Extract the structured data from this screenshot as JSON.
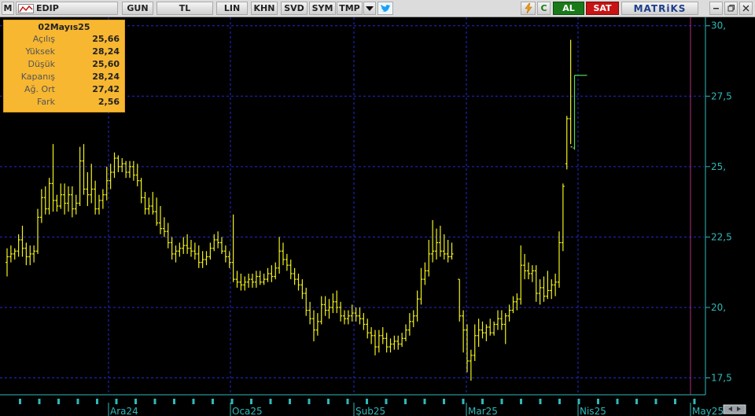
{
  "toolbar": {
    "logo_letter": "M",
    "symbol": "EDIP",
    "period": "GUN",
    "currency": "TL",
    "scale": "LIN",
    "buttons": [
      "KHN",
      "SVD",
      "SYM",
      "TMP"
    ],
    "c_label": "C",
    "buy_label": "AL",
    "sell_label": "SAT",
    "brand": "MATRiKS",
    "icons": [
      "chart-mode-icon",
      "dropdown-arrow-icon",
      "twitter-icon",
      "lightning-icon",
      "minimize-icon",
      "restore-icon",
      "close-icon"
    ]
  },
  "infobox": {
    "date": "02Mayıs25",
    "rows": [
      {
        "label": "Açılış",
        "value": "25,66"
      },
      {
        "label": "Yüksek",
        "value": "28,24"
      },
      {
        "label": "Düşük",
        "value": "25,60"
      },
      {
        "label": "Kapanış",
        "value": "28,24"
      },
      {
        "label": "Ağ. Ort",
        "value": "27,42"
      },
      {
        "label": "Fark",
        "value": "2,56"
      }
    ]
  },
  "colors": {
    "background": "#000000",
    "bars": "#f2f21a",
    "last_bar": "#5ad85a",
    "axis": "#2fb9b9",
    "grid": "#1f2bd0",
    "cursor_line": "#b0307a",
    "infobox_bg": "#f7b731"
  },
  "chart_data": {
    "type": "ohlc",
    "title": "EDIP",
    "y_ticks": [
      "30,",
      "27,5",
      "25,",
      "22,5",
      "20,",
      "17,5"
    ],
    "y_tick_values": [
      30,
      27.5,
      25,
      22.5,
      20,
      17.5
    ],
    "ylim": [
      16.9,
      30.3
    ],
    "x_labels": [
      "Ara24",
      "Oca25",
      "Şub25",
      "Mar25",
      "Nis25",
      "May25"
    ],
    "grid": true,
    "bars": [
      {
        "o": 21.6,
        "h": 22.1,
        "l": 21.1,
        "c": 21.8
      },
      {
        "o": 21.8,
        "h": 22.2,
        "l": 21.6,
        "c": 21.9
      },
      {
        "o": 21.9,
        "h": 22.1,
        "l": 21.7,
        "c": 22.0
      },
      {
        "o": 22.0,
        "h": 22.6,
        "l": 21.8,
        "c": 22.4
      },
      {
        "o": 22.4,
        "h": 22.9,
        "l": 21.8,
        "c": 22.1
      },
      {
        "o": 22.1,
        "h": 22.3,
        "l": 21.5,
        "c": 21.8
      },
      {
        "o": 21.8,
        "h": 22.2,
        "l": 21.5,
        "c": 21.9
      },
      {
        "o": 21.9,
        "h": 22.2,
        "l": 21.6,
        "c": 22.0
      },
      {
        "o": 22.0,
        "h": 23.5,
        "l": 21.9,
        "c": 23.2
      },
      {
        "o": 23.2,
        "h": 24.2,
        "l": 23.0,
        "c": 23.9
      },
      {
        "o": 23.9,
        "h": 24.3,
        "l": 23.3,
        "c": 23.5
      },
      {
        "o": 23.5,
        "h": 24.6,
        "l": 23.3,
        "c": 24.4
      },
      {
        "o": 24.4,
        "h": 25.8,
        "l": 23.4,
        "c": 23.8
      },
      {
        "o": 23.8,
        "h": 24.0,
        "l": 23.4,
        "c": 23.6
      },
      {
        "o": 23.6,
        "h": 24.4,
        "l": 23.5,
        "c": 24.0
      },
      {
        "o": 24.0,
        "h": 24.4,
        "l": 23.3,
        "c": 23.7
      },
      {
        "o": 23.7,
        "h": 24.3,
        "l": 23.4,
        "c": 24.0
      },
      {
        "o": 24.0,
        "h": 24.3,
        "l": 23.2,
        "c": 23.5
      },
      {
        "o": 23.5,
        "h": 24.0,
        "l": 23.3,
        "c": 23.7
      },
      {
        "o": 23.7,
        "h": 25.7,
        "l": 23.6,
        "c": 25.2
      },
      {
        "o": 25.2,
        "h": 25.8,
        "l": 24.0,
        "c": 24.2
      },
      {
        "o": 24.2,
        "h": 24.8,
        "l": 23.6,
        "c": 24.0
      },
      {
        "o": 24.0,
        "h": 25.1,
        "l": 23.7,
        "c": 24.2
      },
      {
        "o": 24.2,
        "h": 24.5,
        "l": 23.3,
        "c": 23.5
      },
      {
        "o": 23.5,
        "h": 24.0,
        "l": 23.3,
        "c": 23.8
      },
      {
        "o": 23.8,
        "h": 24.2,
        "l": 23.5,
        "c": 24.0
      },
      {
        "o": 24.0,
        "h": 25.0,
        "l": 23.8,
        "c": 24.5
      },
      {
        "o": 24.5,
        "h": 25.1,
        "l": 24.2,
        "c": 24.8
      },
      {
        "o": 24.8,
        "h": 25.5,
        "l": 24.6,
        "c": 25.3
      },
      {
        "o": 25.3,
        "h": 25.4,
        "l": 24.8,
        "c": 25.0
      },
      {
        "o": 25.0,
        "h": 25.3,
        "l": 24.8,
        "c": 25.1
      },
      {
        "o": 25.1,
        "h": 25.2,
        "l": 24.6,
        "c": 24.8
      },
      {
        "o": 24.8,
        "h": 25.2,
        "l": 24.6,
        "c": 25.0
      },
      {
        "o": 25.0,
        "h": 25.2,
        "l": 24.5,
        "c": 24.7
      },
      {
        "o": 24.7,
        "h": 25.1,
        "l": 24.3,
        "c": 24.5
      },
      {
        "o": 24.5,
        "h": 24.6,
        "l": 23.7,
        "c": 23.9
      },
      {
        "o": 23.9,
        "h": 24.1,
        "l": 23.3,
        "c": 23.5
      },
      {
        "o": 23.5,
        "h": 23.9,
        "l": 23.3,
        "c": 23.6
      },
      {
        "o": 23.6,
        "h": 24.1,
        "l": 23.3,
        "c": 23.4
      },
      {
        "o": 23.4,
        "h": 23.9,
        "l": 22.9,
        "c": 23.0
      },
      {
        "o": 23.0,
        "h": 23.6,
        "l": 22.6,
        "c": 22.8
      },
      {
        "o": 22.8,
        "h": 23.2,
        "l": 22.5,
        "c": 22.7
      },
      {
        "o": 22.7,
        "h": 23.0,
        "l": 22.1,
        "c": 22.3
      },
      {
        "o": 22.3,
        "h": 22.5,
        "l": 21.7,
        "c": 21.9
      },
      {
        "o": 21.9,
        "h": 22.2,
        "l": 21.6,
        "c": 22.0
      },
      {
        "o": 22.0,
        "h": 22.3,
        "l": 21.8,
        "c": 22.1
      },
      {
        "o": 22.1,
        "h": 22.5,
        "l": 21.9,
        "c": 22.2
      },
      {
        "o": 22.2,
        "h": 22.6,
        "l": 21.9,
        "c": 22.1
      },
      {
        "o": 22.1,
        "h": 22.4,
        "l": 21.8,
        "c": 22.0
      },
      {
        "o": 22.0,
        "h": 22.3,
        "l": 21.7,
        "c": 21.9
      },
      {
        "o": 21.9,
        "h": 22.2,
        "l": 21.4,
        "c": 21.6
      },
      {
        "o": 21.6,
        "h": 22.0,
        "l": 21.4,
        "c": 21.7
      },
      {
        "o": 21.7,
        "h": 22.0,
        "l": 21.5,
        "c": 21.8
      },
      {
        "o": 21.8,
        "h": 22.3,
        "l": 21.7,
        "c": 22.1
      },
      {
        "o": 22.1,
        "h": 22.6,
        "l": 22.0,
        "c": 22.4
      },
      {
        "o": 22.4,
        "h": 22.7,
        "l": 22.1,
        "c": 22.3
      },
      {
        "o": 22.3,
        "h": 22.5,
        "l": 21.9,
        "c": 22.0
      },
      {
        "o": 22.0,
        "h": 22.2,
        "l": 21.6,
        "c": 21.8
      },
      {
        "o": 21.8,
        "h": 22.0,
        "l": 21.4,
        "c": 21.6
      },
      {
        "o": 21.6,
        "h": 23.3,
        "l": 20.9,
        "c": 21.0
      },
      {
        "o": 21.0,
        "h": 21.3,
        "l": 20.7,
        "c": 20.9
      },
      {
        "o": 20.9,
        "h": 21.2,
        "l": 20.6,
        "c": 20.8
      },
      {
        "o": 20.8,
        "h": 21.1,
        "l": 20.6,
        "c": 20.9
      },
      {
        "o": 20.9,
        "h": 21.2,
        "l": 20.7,
        "c": 21.0
      },
      {
        "o": 21.0,
        "h": 21.2,
        "l": 20.7,
        "c": 20.9
      },
      {
        "o": 20.9,
        "h": 21.3,
        "l": 20.7,
        "c": 21.1
      },
      {
        "o": 21.1,
        "h": 21.3,
        "l": 20.8,
        "c": 20.9
      },
      {
        "o": 20.9,
        "h": 21.2,
        "l": 20.8,
        "c": 21.0
      },
      {
        "o": 21.0,
        "h": 21.4,
        "l": 20.9,
        "c": 21.2
      },
      {
        "o": 21.2,
        "h": 21.5,
        "l": 20.9,
        "c": 21.1
      },
      {
        "o": 21.1,
        "h": 21.6,
        "l": 21.0,
        "c": 21.4
      },
      {
        "o": 21.4,
        "h": 22.5,
        "l": 21.2,
        "c": 22.0
      },
      {
        "o": 22.0,
        "h": 22.3,
        "l": 21.5,
        "c": 21.7
      },
      {
        "o": 21.7,
        "h": 21.9,
        "l": 21.3,
        "c": 21.5
      },
      {
        "o": 21.5,
        "h": 21.7,
        "l": 21.0,
        "c": 21.2
      },
      {
        "o": 21.2,
        "h": 21.4,
        "l": 20.8,
        "c": 21.0
      },
      {
        "o": 21.0,
        "h": 21.2,
        "l": 20.6,
        "c": 20.8
      },
      {
        "o": 20.8,
        "h": 21.0,
        "l": 20.3,
        "c": 20.5
      },
      {
        "o": 20.5,
        "h": 20.7,
        "l": 19.7,
        "c": 19.9
      },
      {
        "o": 19.9,
        "h": 20.2,
        "l": 19.4,
        "c": 19.6
      },
      {
        "o": 19.6,
        "h": 19.9,
        "l": 18.8,
        "c": 19.2
      },
      {
        "o": 19.2,
        "h": 19.8,
        "l": 19.0,
        "c": 19.5
      },
      {
        "o": 19.5,
        "h": 20.4,
        "l": 19.4,
        "c": 20.1
      },
      {
        "o": 20.1,
        "h": 20.4,
        "l": 19.7,
        "c": 19.9
      },
      {
        "o": 19.9,
        "h": 20.3,
        "l": 19.6,
        "c": 20.0
      },
      {
        "o": 20.0,
        "h": 20.5,
        "l": 19.8,
        "c": 20.2
      },
      {
        "o": 20.2,
        "h": 20.6,
        "l": 19.8,
        "c": 20.0
      },
      {
        "o": 20.0,
        "h": 20.2,
        "l": 19.5,
        "c": 19.7
      },
      {
        "o": 19.7,
        "h": 19.9,
        "l": 19.4,
        "c": 19.6
      },
      {
        "o": 19.6,
        "h": 19.9,
        "l": 19.4,
        "c": 19.7
      },
      {
        "o": 19.7,
        "h": 20.1,
        "l": 19.5,
        "c": 19.8
      },
      {
        "o": 19.8,
        "h": 20.0,
        "l": 19.5,
        "c": 19.7
      },
      {
        "o": 19.7,
        "h": 20.0,
        "l": 19.4,
        "c": 19.6
      },
      {
        "o": 19.6,
        "h": 19.8,
        "l": 19.2,
        "c": 19.4
      },
      {
        "o": 19.4,
        "h": 19.6,
        "l": 18.9,
        "c": 19.1
      },
      {
        "o": 19.1,
        "h": 19.3,
        "l": 18.7,
        "c": 19.0
      },
      {
        "o": 19.0,
        "h": 19.2,
        "l": 18.3,
        "c": 18.6
      },
      {
        "o": 18.6,
        "h": 19.2,
        "l": 18.4,
        "c": 19.0
      },
      {
        "o": 19.0,
        "h": 19.3,
        "l": 18.7,
        "c": 18.9
      },
      {
        "o": 18.9,
        "h": 19.1,
        "l": 18.4,
        "c": 18.6
      },
      {
        "o": 18.6,
        "h": 18.9,
        "l": 18.4,
        "c": 18.7
      },
      {
        "o": 18.7,
        "h": 19.0,
        "l": 18.5,
        "c": 18.8
      },
      {
        "o": 18.8,
        "h": 19.0,
        "l": 18.5,
        "c": 18.7
      },
      {
        "o": 18.7,
        "h": 19.1,
        "l": 18.6,
        "c": 18.9
      },
      {
        "o": 18.9,
        "h": 19.4,
        "l": 18.8,
        "c": 19.2
      },
      {
        "o": 19.2,
        "h": 19.8,
        "l": 19.0,
        "c": 19.5
      },
      {
        "o": 19.5,
        "h": 19.9,
        "l": 19.3,
        "c": 19.7
      },
      {
        "o": 19.7,
        "h": 20.6,
        "l": 19.5,
        "c": 20.3
      },
      {
        "o": 20.3,
        "h": 21.4,
        "l": 20.1,
        "c": 21.0
      },
      {
        "o": 21.0,
        "h": 21.6,
        "l": 20.8,
        "c": 21.3
      },
      {
        "o": 21.3,
        "h": 22.4,
        "l": 21.1,
        "c": 21.9
      },
      {
        "o": 21.9,
        "h": 23.1,
        "l": 21.6,
        "c": 22.0
      },
      {
        "o": 22.0,
        "h": 22.8,
        "l": 21.7,
        "c": 22.3
      },
      {
        "o": 22.3,
        "h": 22.9,
        "l": 21.8,
        "c": 22.0
      },
      {
        "o": 22.0,
        "h": 22.6,
        "l": 21.7,
        "c": 21.9
      },
      {
        "o": 21.9,
        "h": 22.4,
        "l": 21.6,
        "c": 21.8
      },
      {
        "o": 21.8,
        "h": 22.3,
        "l": 21.7,
        "c": 21.9
      },
      null,
      {
        "o": 21.0,
        "h": 21.0,
        "l": 19.5,
        "c": 19.7
      },
      {
        "o": 19.7,
        "h": 19.9,
        "l": 18.4,
        "c": 19.2
      },
      {
        "o": 19.2,
        "h": 19.4,
        "l": 17.7,
        "c": 18.1
      },
      {
        "o": 18.1,
        "h": 18.5,
        "l": 17.4,
        "c": 18.3
      },
      {
        "o": 18.3,
        "h": 19.4,
        "l": 18.1,
        "c": 19.0
      },
      {
        "o": 19.0,
        "h": 19.6,
        "l": 18.6,
        "c": 19.2
      },
      {
        "o": 19.2,
        "h": 19.5,
        "l": 18.9,
        "c": 19.1
      },
      {
        "o": 19.1,
        "h": 19.4,
        "l": 18.8,
        "c": 19.3
      },
      {
        "o": 19.3,
        "h": 19.6,
        "l": 19.0,
        "c": 19.1
      },
      {
        "o": 19.1,
        "h": 19.5,
        "l": 19.0,
        "c": 19.4
      },
      {
        "o": 19.4,
        "h": 19.9,
        "l": 19.2,
        "c": 19.6
      },
      {
        "o": 19.6,
        "h": 19.9,
        "l": 19.2,
        "c": 19.4
      },
      {
        "o": 19.4,
        "h": 19.8,
        "l": 18.7,
        "c": 19.7
      },
      {
        "o": 19.7,
        "h": 20.1,
        "l": 19.5,
        "c": 19.9
      },
      {
        "o": 19.9,
        "h": 20.4,
        "l": 19.8,
        "c": 20.2
      },
      {
        "o": 20.2,
        "h": 20.5,
        "l": 19.9,
        "c": 20.3
      },
      {
        "o": 20.3,
        "h": 22.2,
        "l": 20.1,
        "c": 21.5
      },
      {
        "o": 21.5,
        "h": 21.9,
        "l": 21.0,
        "c": 21.3
      },
      {
        "o": 21.3,
        "h": 21.6,
        "l": 21.0,
        "c": 21.2
      },
      {
        "o": 21.2,
        "h": 21.5,
        "l": 20.9,
        "c": 21.3
      },
      {
        "o": 21.3,
        "h": 21.5,
        "l": 20.2,
        "c": 20.5
      },
      {
        "o": 20.5,
        "h": 21.0,
        "l": 20.1,
        "c": 20.7
      },
      {
        "o": 20.7,
        "h": 21.1,
        "l": 20.2,
        "c": 20.4
      },
      {
        "o": 20.4,
        "h": 21.3,
        "l": 20.3,
        "c": 20.6
      },
      {
        "o": 20.6,
        "h": 21.0,
        "l": 20.3,
        "c": 20.8
      },
      {
        "o": 20.8,
        "h": 21.2,
        "l": 20.4,
        "c": 20.9
      },
      {
        "o": 20.9,
        "h": 22.7,
        "l": 20.7,
        "c": 22.3
      },
      {
        "o": 22.3,
        "h": 24.4,
        "l": 22.0,
        "c": 24.3
      },
      {
        "o": 25.1,
        "h": 26.8,
        "l": 24.9,
        "c": 26.7
      },
      {
        "o": 26.7,
        "h": 29.5,
        "l": 25.8,
        "c": 25.7
      },
      {
        "o": 25.66,
        "h": 28.24,
        "l": 25.6,
        "c": 28.24
      }
    ]
  }
}
